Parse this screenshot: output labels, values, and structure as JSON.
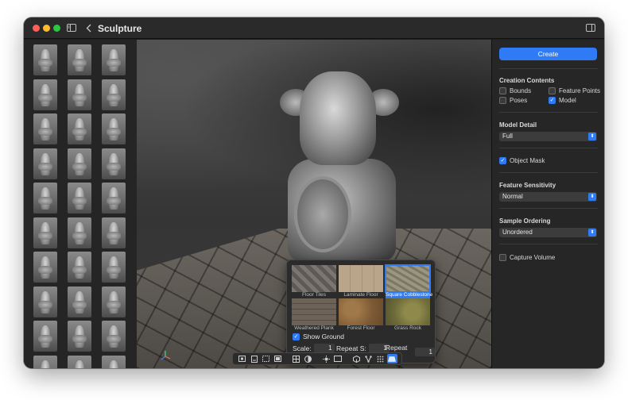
{
  "window": {
    "title": "Sculpture"
  },
  "titlebar": {
    "icons": [
      "sidebar-icon",
      "chevron-left-icon",
      "inspector-icon"
    ]
  },
  "thumbnails": {
    "count_visible": 30,
    "columns": 3
  },
  "materials": {
    "tiles": [
      {
        "label": "Floor Tiles",
        "selected": false
      },
      {
        "label": "Laminate Floor",
        "selected": false
      },
      {
        "label": "Square Cobblestone",
        "selected": true
      },
      {
        "label": "Weathered Plank",
        "selected": false
      },
      {
        "label": "Forest Floor",
        "selected": false
      },
      {
        "label": "Grass Rock",
        "selected": false
      }
    ],
    "show_ground": {
      "label": "Show Ground",
      "checked": true
    },
    "scale": {
      "label": "Scale:",
      "value": "1"
    },
    "repeat_s": {
      "label": "Repeat S:",
      "value": "1"
    },
    "repeat_t": {
      "label": "Repeat T:",
      "value": "1"
    }
  },
  "toolbar": {
    "tools": [
      "frame-icon",
      "camera-icon",
      "grid-view-icon",
      "texture-icon",
      "wireframe-grid-icon",
      "shading-icon",
      "light-icon",
      "box-icon",
      "cube-icon",
      "network-icon",
      "points-icon",
      "ground-icon"
    ],
    "active_tool": "ground-icon"
  },
  "inspector": {
    "create_label": "Create",
    "creation_contents": {
      "label": "Creation Contents",
      "bounds": {
        "label": "Bounds",
        "checked": false
      },
      "feature_points": {
        "label": "Feature Points",
        "checked": false
      },
      "poses": {
        "label": "Poses",
        "checked": false
      },
      "model": {
        "label": "Model",
        "checked": true
      }
    },
    "model_detail": {
      "label": "Model Detail",
      "value": "Full"
    },
    "object_mask": {
      "label": "Object Mask",
      "checked": true
    },
    "feature_sensitivity": {
      "label": "Feature Sensitivity",
      "value": "Normal"
    },
    "sample_ordering": {
      "label": "Sample Ordering",
      "value": "Unordered"
    },
    "capture_volume": {
      "label": "Capture Volume",
      "checked": false
    }
  },
  "colors": {
    "accent": "#2f7bf5",
    "window_bg": "#1e1e1e",
    "panel_bg": "#262626"
  }
}
